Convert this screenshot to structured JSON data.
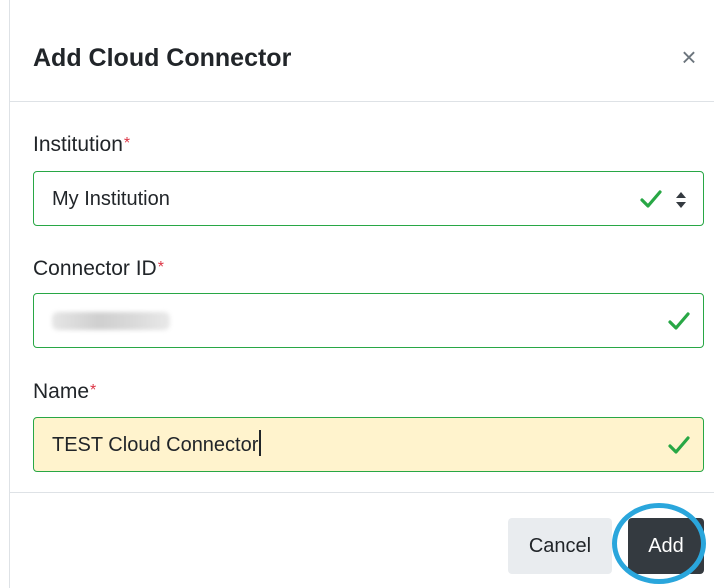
{
  "dialog": {
    "title": "Add Cloud Connector",
    "close_label": "×"
  },
  "form": {
    "required_marker": "*",
    "institution": {
      "label": "Institution",
      "value": "My Institution",
      "valid": true
    },
    "connector_id": {
      "label": "Connector ID",
      "value_redacted": true,
      "valid": true
    },
    "name": {
      "label": "Name",
      "value": "TEST Cloud Connector",
      "valid": true,
      "autofill_highlight": true
    }
  },
  "footer": {
    "cancel_label": "Cancel",
    "add_label": "Add"
  },
  "colors": {
    "valid_green": "#28a745",
    "required_red": "#dc3545",
    "primary_dark": "#343a40",
    "secondary_light": "#e9ecef",
    "autofill_yellow": "#fff3cd",
    "highlight_blue": "#2aa6dc"
  },
  "icons": {
    "valid": "check-icon",
    "select": "sort-arrows-icon",
    "close": "close-icon"
  }
}
